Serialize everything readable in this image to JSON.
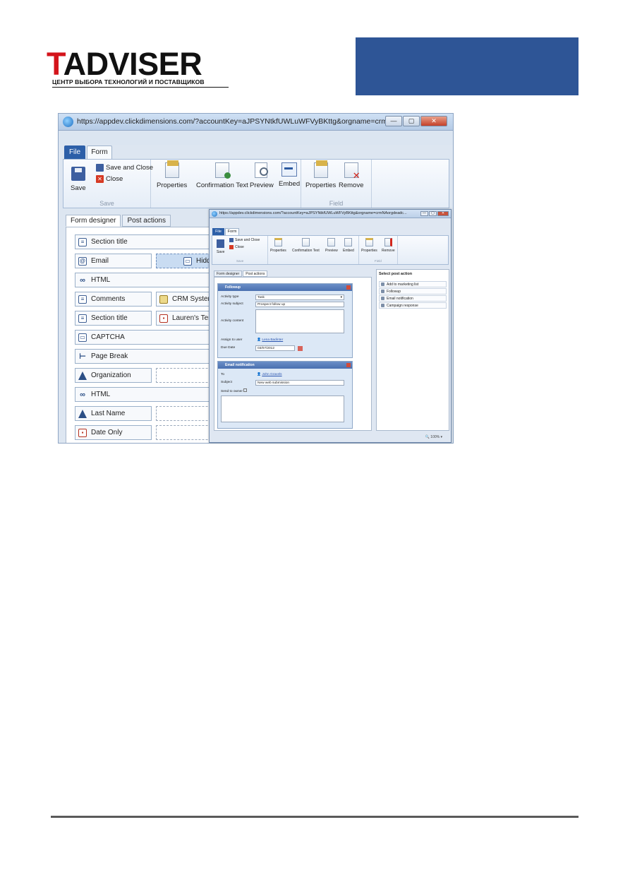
{
  "header": {
    "logo_text": "TADVISER",
    "logo_subtitle": "ЦЕНТР ВЫБОРА ТЕХНОЛОГИЙ И ПОСТАВЩИКОВ",
    "banner_color": "#2e5596"
  },
  "main_window": {
    "url": "https://appdev.clickdimensions.com/?accountKey=aJPSYNtkfUWLuWFVyBKttg&orgname=crmNAorgdeadc...",
    "window_buttons": [
      "—",
      "▢",
      "✕"
    ],
    "tabs": {
      "file": "File",
      "form": "Form"
    },
    "ribbon": {
      "save": "Save",
      "save_and_close": "Save and Close",
      "close": "Close",
      "save_group": "Save",
      "properties": "Properties",
      "confirmation_text": "Confirmation Text",
      "preview": "Preview",
      "embed": "Embed",
      "field_properties": "Properties",
      "remove": "Remove",
      "field_group": "Field"
    },
    "subtabs": {
      "designer": "Form designer",
      "post_actions": "Post actions"
    },
    "fields": {
      "section_title_1": "Section title",
      "email": "Email",
      "hidden": "Hidde",
      "html_1": "HTML",
      "comments": "Comments",
      "crm_system": "CRM System",
      "section_title_2": "Section title",
      "laurens_test": "Lauren's Test F",
      "captcha": "CAPTCHA",
      "page_break": "Page Break",
      "organization": "Organization",
      "html_2": "HTML",
      "last_name": "Last Name",
      "date_only": "Date Only"
    }
  },
  "overlay_window": {
    "url": "https://appdev.clickdimensions.com/?accountKey=aJPSYNtkfUWLuWFVyBKttg&orgname=crmNAorgdeadc...",
    "tabs": {
      "file": "File",
      "form": "Form"
    },
    "ribbon": {
      "save": "Save",
      "save_and_close": "Save and Close",
      "close": "Close",
      "save_group": "Save",
      "properties": "Properties",
      "confirmation_text": "Confirmation Text",
      "preview": "Preview",
      "embed": "Embed",
      "field_properties": "Properties",
      "remove": "Remove",
      "field_group": "Field"
    },
    "subtabs": {
      "designer": "Form designer",
      "post_actions": "Post actions"
    },
    "followup": {
      "title": "Followup",
      "activity_type_label": "Activity type",
      "activity_type_value": "Task",
      "activity_subject_label": "Activity subject",
      "activity_subject_value": "Prospect follow up",
      "activity_content_label": "Activity content",
      "assign_to_user_label": "Assign to user",
      "assign_to_user_value": "Lena Badinter",
      "due_date_label": "Due Date",
      "due_date_value": "03/07/2012"
    },
    "email_notification": {
      "title": "Email notification",
      "to_label": "To",
      "to_value": "John Gravels",
      "subject_label": "Subject",
      "subject_value": "New web submission",
      "send_to_owner_label": "Send to owner"
    },
    "post_action_panel": {
      "title": "Select post action",
      "actions": [
        "Add to marketing list",
        "Followup",
        "Email notification",
        "Campaign response"
      ]
    },
    "zoom": "100%"
  }
}
